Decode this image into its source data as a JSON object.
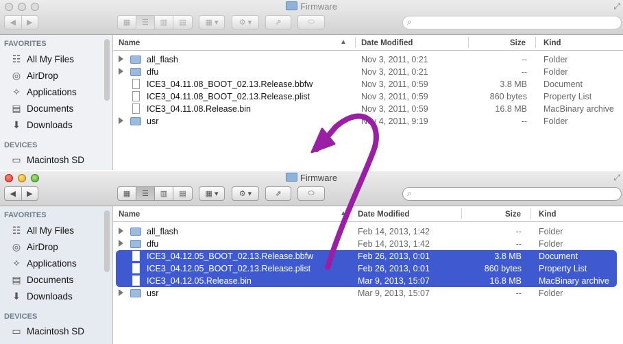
{
  "top_window": {
    "title": "Firmware",
    "sidebar": {
      "favorites_heading": "FAVORITES",
      "items": [
        {
          "label": "All My Files",
          "icon": "all-files-icon"
        },
        {
          "label": "AirDrop",
          "icon": "airdrop-icon"
        },
        {
          "label": "Applications",
          "icon": "applications-icon"
        },
        {
          "label": "Documents",
          "icon": "documents-icon"
        },
        {
          "label": "Downloads",
          "icon": "downloads-icon"
        }
      ],
      "devices_heading": "DEVICES",
      "devices": [
        {
          "label": "Macintosh SD",
          "icon": "disk-icon"
        }
      ]
    },
    "columns": {
      "name": "Name",
      "date": "Date Modified",
      "size": "Size",
      "kind": "Kind"
    },
    "rows": [
      {
        "name": "all_flash",
        "date": "Nov 3, 2011, 0:21",
        "size": "--",
        "kind": "Folder"
      },
      {
        "name": "dfu",
        "date": "Nov 3, 2011, 0:21",
        "size": "--",
        "kind": "Folder"
      },
      {
        "name": "ICE3_04.11.08_BOOT_02.13.Release.bbfw",
        "date": "Nov 3, 2011, 0:59",
        "size": "3.8 MB",
        "kind": "Document"
      },
      {
        "name": "ICE3_04.11.08_BOOT_02.13.Release.plist",
        "date": "Nov 3, 2011, 0:59",
        "size": "860 bytes",
        "kind": "Property List"
      },
      {
        "name": "ICE3_04.11.08.Release.bin",
        "date": "Nov 3, 2011, 0:59",
        "size": "16.8 MB",
        "kind": "MacBinary archive"
      },
      {
        "name": "usr",
        "date": "Nov 4, 2011, 9:19",
        "size": "--",
        "kind": "Folder"
      }
    ]
  },
  "bottom_window": {
    "title": "Firmware",
    "sidebar": {
      "favorites_heading": "FAVORITES",
      "items": [
        {
          "label": "All My Files",
          "icon": "all-files-icon"
        },
        {
          "label": "AirDrop",
          "icon": "airdrop-icon"
        },
        {
          "label": "Applications",
          "icon": "applications-icon"
        },
        {
          "label": "Documents",
          "icon": "documents-icon"
        },
        {
          "label": "Downloads",
          "icon": "downloads-icon"
        }
      ],
      "devices_heading": "DEVICES",
      "devices": [
        {
          "label": "Macintosh SD",
          "icon": "disk-icon"
        }
      ]
    },
    "columns": {
      "name": "Name",
      "date": "Date Modified",
      "size": "Size",
      "kind": "Kind"
    },
    "rows": [
      {
        "name": "all_flash",
        "date": "Feb 14, 2013, 1:42",
        "size": "--",
        "kind": "Folder"
      },
      {
        "name": "dfu",
        "date": "Feb 14, 2013, 1:42",
        "size": "--",
        "kind": "Folder"
      },
      {
        "name": "ICE3_04.12.05_BOOT_02.13.Release.bbfw",
        "date": "Feb 26, 2013, 0:01",
        "size": "3.8 MB",
        "kind": "Document"
      },
      {
        "name": "ICE3_04.12.05_BOOT_02.13.Release.plist",
        "date": "Feb 26, 2013, 0:01",
        "size": "860 bytes",
        "kind": "Property List"
      },
      {
        "name": "ICE3_04.12.05.Release.bin",
        "date": "Mar 9, 2013, 15:07",
        "size": "16.8 MB",
        "kind": "MacBinary archive"
      },
      {
        "name": "usr",
        "date": "Mar 9, 2013, 15:07",
        "size": "--",
        "kind": "Folder"
      }
    ]
  },
  "colors": {
    "selection": "#3f5ad1",
    "annotation_arrow": "#9a1fa5",
    "sidebar_bg": "#e6ebf1"
  }
}
